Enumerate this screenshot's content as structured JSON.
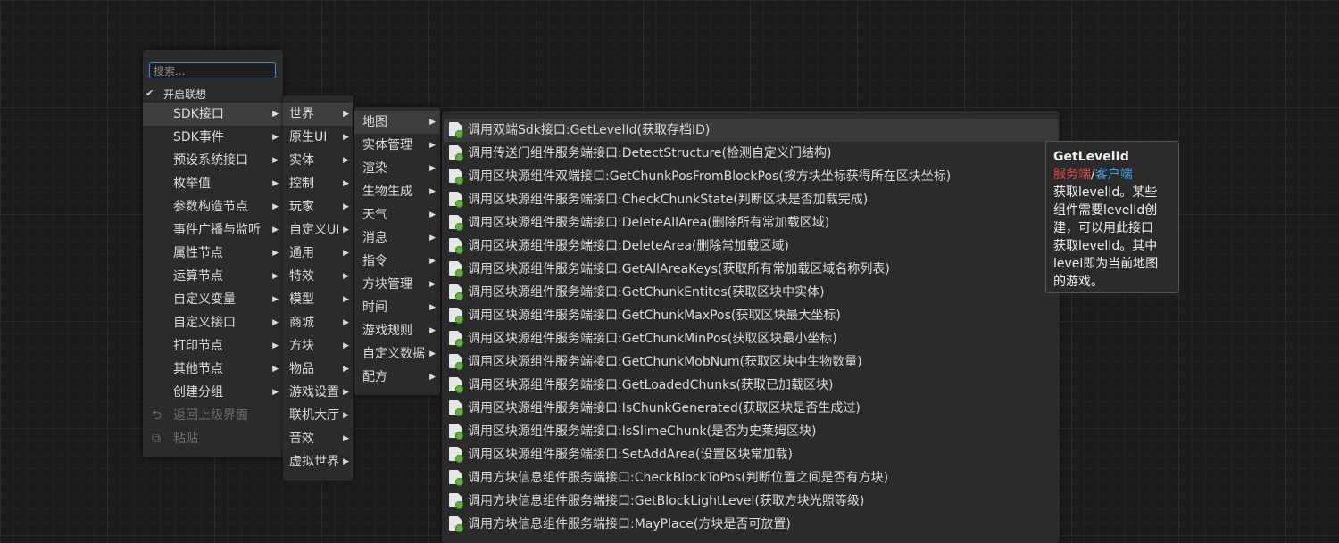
{
  "root_menu": {
    "search_placeholder": "搜索...",
    "association_label": "开启联想",
    "items": [
      {
        "label": "SDK接口"
      },
      {
        "label": "SDK事件"
      },
      {
        "label": "预设系统接口"
      },
      {
        "label": "枚举值"
      },
      {
        "label": "参数构造节点"
      },
      {
        "label": "事件广播与监听"
      },
      {
        "label": "属性节点"
      },
      {
        "label": "运算节点"
      },
      {
        "label": "自定义变量"
      },
      {
        "label": "自定义接口"
      },
      {
        "label": "打印节点"
      },
      {
        "label": "其他节点"
      },
      {
        "label": "创建分组"
      }
    ],
    "back_label": "返回上级界面",
    "paste_label": "粘贴"
  },
  "world_menu": {
    "items": [
      {
        "label": "世界"
      },
      {
        "label": "原生UI"
      },
      {
        "label": "实体"
      },
      {
        "label": "控制"
      },
      {
        "label": "玩家"
      },
      {
        "label": "自定义UI"
      },
      {
        "label": "通用"
      },
      {
        "label": "特效"
      },
      {
        "label": "模型"
      },
      {
        "label": "商城"
      },
      {
        "label": "方块"
      },
      {
        "label": "物品"
      },
      {
        "label": "游戏设置"
      },
      {
        "label": "联机大厅"
      },
      {
        "label": "音效"
      },
      {
        "label": "虚拟世界"
      }
    ]
  },
  "map_menu": {
    "items": [
      {
        "label": "地图"
      },
      {
        "label": "实体管理"
      },
      {
        "label": "渲染"
      },
      {
        "label": "生物生成"
      },
      {
        "label": "天气"
      },
      {
        "label": "消息"
      },
      {
        "label": "指令"
      },
      {
        "label": "方块管理"
      },
      {
        "label": "时间"
      },
      {
        "label": "游戏规则"
      },
      {
        "label": "自定义数据"
      },
      {
        "label": "配方"
      }
    ]
  },
  "api_list": {
    "items": [
      {
        "label": "调用双端Sdk接口:GetLevelId(获取存档ID)"
      },
      {
        "label": "调用传送门组件服务端接口:DetectStructure(检测自定义门结构)"
      },
      {
        "label": "调用区块源组件双端接口:GetChunkPosFromBlockPos(按方块坐标获得所在区块坐标)"
      },
      {
        "label": "调用区块源组件服务端接口:CheckChunkState(判断区块是否加载完成)"
      },
      {
        "label": "调用区块源组件服务端接口:DeleteAllArea(删除所有常加载区域)"
      },
      {
        "label": "调用区块源组件服务端接口:DeleteArea(删除常加载区域)"
      },
      {
        "label": "调用区块源组件服务端接口:GetAllAreaKeys(获取所有常加载区域名称列表)"
      },
      {
        "label": "调用区块源组件服务端接口:GetChunkEntites(获取区块中实体)"
      },
      {
        "label": "调用区块源组件服务端接口:GetChunkMaxPos(获取区块最大坐标)"
      },
      {
        "label": "调用区块源组件服务端接口:GetChunkMinPos(获取区块最小坐标)"
      },
      {
        "label": "调用区块源组件服务端接口:GetChunkMobNum(获取区块中生物数量)"
      },
      {
        "label": "调用区块源组件服务端接口:GetLoadedChunks(获取已加载区块)"
      },
      {
        "label": "调用区块源组件服务端接口:IsChunkGenerated(获取区块是否生成过)"
      },
      {
        "label": "调用区块源组件服务端接口:IsSlimeChunk(是否为史莱姆区块)"
      },
      {
        "label": "调用区块源组件服务端接口:SetAddArea(设置区块常加载)"
      },
      {
        "label": "调用方块信息组件服务端接口:CheckBlockToPos(判断位置之间是否有方块)"
      },
      {
        "label": "调用方块信息组件服务端接口:GetBlockLightLevel(获取方块光照等级)"
      },
      {
        "label": "调用方块信息组件服务端接口:MayPlace(方块是否可放置)"
      }
    ]
  },
  "tooltip": {
    "title": "GetLevelId",
    "server": "服务端",
    "sep": "/",
    "client": "客户端",
    "lines": [
      "获取levelId。某些",
      "组件需要levelId创",
      "建，可以用此接口",
      "获取levelId。其中",
      "level即为当前地图",
      "的游戏。"
    ]
  }
}
